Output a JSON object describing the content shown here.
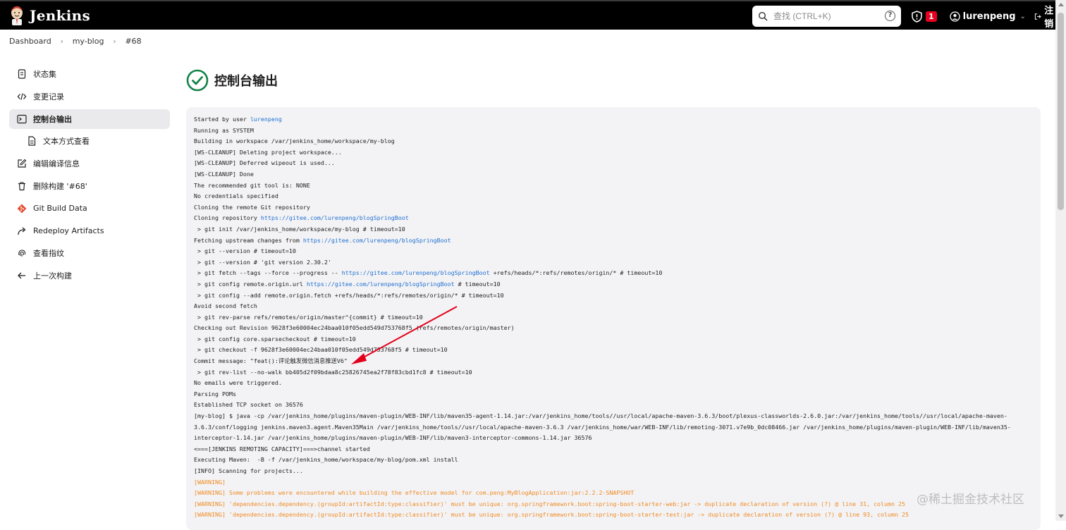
{
  "header": {
    "app_name": "Jenkins",
    "search_placeholder": "查找 (CTRL+K)",
    "help_glyph": "?",
    "security_count": "1",
    "username": "lurenpeng",
    "logout_label": "注销"
  },
  "breadcrumb": [
    "Dashboard",
    "my-blog",
    "#68"
  ],
  "sidebar": {
    "items": [
      {
        "label": "状态集",
        "icon": "document-icon"
      },
      {
        "label": "变更记录",
        "icon": "code-icon"
      },
      {
        "label": "控制台输出",
        "icon": "terminal-icon",
        "active": true
      },
      {
        "label": "文本方式查看",
        "icon": "document-icon",
        "sub": true
      },
      {
        "label": "编辑编译信息",
        "icon": "edit-icon"
      },
      {
        "label": "删除构建 '#68'",
        "icon": "trash-icon"
      },
      {
        "label": "Git Build Data",
        "icon": "git-icon"
      },
      {
        "label": "Redeploy Artifacts",
        "icon": "redeploy-icon"
      },
      {
        "label": "查看指纹",
        "icon": "fingerprint-icon"
      },
      {
        "label": "上一次构建",
        "icon": "arrow-left-icon"
      }
    ]
  },
  "main": {
    "title": "控制台输出",
    "console_lines": [
      {
        "segments": [
          {
            "text": "Started by user "
          },
          {
            "text": "lurenpeng",
            "link": true
          }
        ]
      },
      {
        "segments": [
          {
            "text": "Running as SYSTEM"
          }
        ]
      },
      {
        "segments": [
          {
            "text": "Building in workspace /var/jenkins_home/workspace/my-blog"
          }
        ]
      },
      {
        "segments": [
          {
            "text": "[WS-CLEANUP] Deleting project workspace..."
          }
        ]
      },
      {
        "segments": [
          {
            "text": "[WS-CLEANUP] Deferred wipeout is used..."
          }
        ]
      },
      {
        "segments": [
          {
            "text": "[WS-CLEANUP] Done"
          }
        ]
      },
      {
        "segments": [
          {
            "text": "The recommended git tool is: NONE"
          }
        ]
      },
      {
        "segments": [
          {
            "text": "No credentials specified"
          }
        ]
      },
      {
        "segments": [
          {
            "text": "Cloning the remote Git repository"
          }
        ]
      },
      {
        "segments": [
          {
            "text": "Cloning repository "
          },
          {
            "text": "https://gitee.com/lurenpeng/blogSpringBoot",
            "link": true
          }
        ]
      },
      {
        "segments": [
          {
            "text": " > git init /var/jenkins_home/workspace/my-blog # timeout=10"
          }
        ]
      },
      {
        "segments": [
          {
            "text": "Fetching upstream changes from "
          },
          {
            "text": "https://gitee.com/lurenpeng/blogSpringBoot",
            "link": true
          }
        ]
      },
      {
        "segments": [
          {
            "text": " > git --version # timeout=10"
          }
        ]
      },
      {
        "segments": [
          {
            "text": " > git --version # 'git version 2.30.2'"
          }
        ]
      },
      {
        "segments": [
          {
            "text": " > git fetch --tags --force --progress -- "
          },
          {
            "text": "https://gitee.com/lurenpeng/blogSpringBoot",
            "link": true
          },
          {
            "text": " +refs/heads/*:refs/remotes/origin/* # timeout=10"
          }
        ]
      },
      {
        "segments": [
          {
            "text": " > git config remote.origin.url "
          },
          {
            "text": "https://gitee.com/lurenpeng/blogSpringBoot",
            "link": true
          },
          {
            "text": " # timeout=10"
          }
        ]
      },
      {
        "segments": [
          {
            "text": " > git config --add remote.origin.fetch +refs/heads/*:refs/remotes/origin/* # timeout=10"
          }
        ]
      },
      {
        "segments": [
          {
            "text": "Avoid second fetch"
          }
        ]
      },
      {
        "segments": [
          {
            "text": " > git rev-parse refs/remotes/origin/master^{commit} # timeout=10"
          }
        ]
      },
      {
        "segments": [
          {
            "text": "Checking out Revision 9628f3e60004ec24baa010f05edd549d753768f5 (refs/remotes/origin/master)"
          }
        ]
      },
      {
        "segments": [
          {
            "text": " > git config core.sparsecheckout # timeout=10"
          }
        ]
      },
      {
        "segments": [
          {
            "text": " > git checkout -f 9628f3e60004ec24baa010f05edd549d753768f5 # timeout=10"
          }
        ]
      },
      {
        "segments": [
          {
            "text": "Commit message: \"feat():评论触发微信消息推送V6\""
          }
        ]
      },
      {
        "segments": [
          {
            "text": " > git rev-list --no-walk bb405d2f09bdaa8c25826745ea2f78f83cbd1fc8 # timeout=10"
          }
        ]
      },
      {
        "segments": [
          {
            "text": "No emails were triggered."
          }
        ]
      },
      {
        "segments": [
          {
            "text": "Parsing POMs"
          }
        ]
      },
      {
        "segments": [
          {
            "text": "Established TCP socket on 36576"
          }
        ]
      },
      {
        "segments": [
          {
            "text": "[my-blog] $ java -cp /var/jenkins_home/plugins/maven-plugin/WEB-INF/lib/maven35-agent-1.14.jar:/var/jenkins_home/tools//usr/local/apache-maven-3.6.3/boot/plexus-classworlds-2.6.0.jar:/var/jenkins_home/tools//usr/local/apache-maven-"
          }
        ]
      },
      {
        "segments": [
          {
            "text": "3.6.3/conf/logging jenkins.maven3.agent.Maven35Main /var/jenkins_home/tools//usr/local/apache-maven-3.6.3 /var/jenkins_home/war/WEB-INF/lib/remoting-3071.v7e9b_0dc08466.jar /var/jenkins_home/plugins/maven-plugin/WEB-INF/lib/maven35-"
          }
        ]
      },
      {
        "segments": [
          {
            "text": "interceptor-1.14.jar /var/jenkins_home/plugins/maven-plugin/WEB-INF/lib/maven3-interceptor-commons-1.14.jar 36576"
          }
        ]
      },
      {
        "segments": [
          {
            "text": "<===[JENKINS REMOTING CAPACITY]===>channel started"
          }
        ]
      },
      {
        "segments": [
          {
            "text": "Executing Maven:  -B -f /var/jenkins_home/workspace/my-blog/pom.xml install"
          }
        ]
      },
      {
        "segments": [
          {
            "text": "[INFO] Scanning for projects..."
          }
        ]
      },
      {
        "warn": true,
        "segments": [
          {
            "text": "[WARNING]"
          }
        ]
      },
      {
        "warn": true,
        "segments": [
          {
            "text": "[WARNING] Some problems were encountered while building the effective model for com.peng:MyBlogApplication:jar:2.2.2-SNAPSHOT"
          }
        ]
      },
      {
        "warn": true,
        "segments": [
          {
            "text": "[WARNING] 'dependencies.dependency.(groupId:artifactId:type:classifier)' must be unique: org.springframework.boot:spring-boot-starter-web:jar -> duplicate declaration of version (?) @ line 31, column 25"
          }
        ]
      },
      {
        "warn": true,
        "segments": [
          {
            "text": "[WARNING] 'dependencies.dependency.(groupId:artifactId:type:classifier)' must be unique: org.springframework.boot:spring-boot-starter-test:jar -> duplicate declaration of version (?) @ line 93, column 25"
          }
        ]
      }
    ]
  },
  "watermark": "@稀土掘金技术社区",
  "colors": {
    "header_bg": "#000000",
    "badge": "#e6001f",
    "success_green": "#138347",
    "link": "#1f6fd1",
    "warning": "#f08a24",
    "arrow": "#e3001b",
    "console_bg": "#f3f3f5"
  }
}
